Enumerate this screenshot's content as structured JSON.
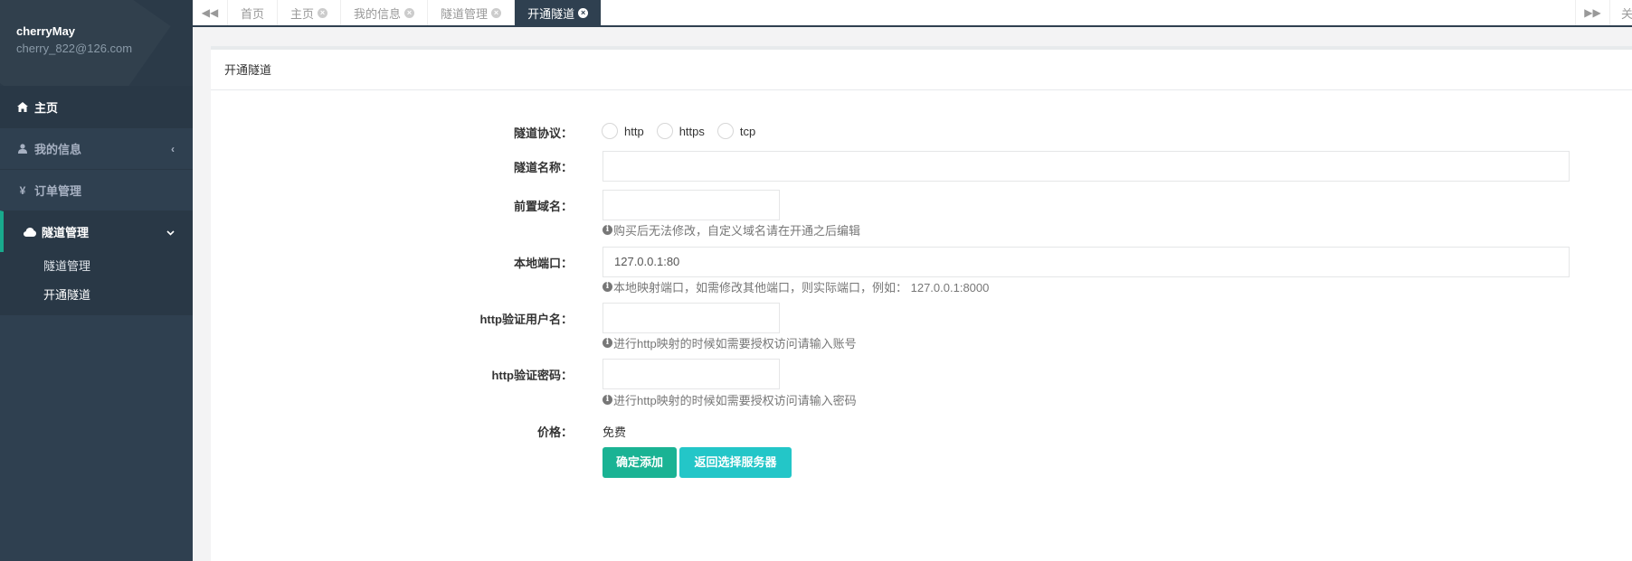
{
  "profile": {
    "name": "cherryMay",
    "email": "cherry_822@126.com"
  },
  "nav": {
    "home": "主页",
    "my_info": "我的信息",
    "orders": "订单管理",
    "tunnels": "隧道管理",
    "sub": [
      "隧道管理",
      "开通隧道"
    ]
  },
  "tabs": {
    "items": [
      {
        "label": "首页",
        "closable": false
      },
      {
        "label": "主页",
        "closable": true
      },
      {
        "label": "我的信息",
        "closable": true
      },
      {
        "label": "隧道管理",
        "closable": true
      },
      {
        "label": "开通隧道",
        "closable": true,
        "active": true
      }
    ],
    "close_label": "关闭"
  },
  "page": {
    "title": "开通隧道",
    "form": {
      "protocol_label": "隧道协议：",
      "protocol_options": [
        "http",
        "https",
        "tcp"
      ],
      "name_label": "隧道名称：",
      "name_value": "",
      "prefix_label": "前置域名：",
      "prefix_value": "",
      "prefix_help": "购买后无法修改，自定义域名请在开通之后编辑",
      "port_label": "本地端口：",
      "port_value": "127.0.0.1:80",
      "port_help": "本地映射端口，如需修改其他端口，则实际端口，例如： 127.0.0.1:8000",
      "user_label": "http验证用户名：",
      "user_value": "",
      "user_help": "进行http映射的时候如需要授权访问请输入账号",
      "pass_label": "http验证密码：",
      "pass_value": "",
      "pass_help": "进行http映射的时候如需要授权访问请输入密码",
      "price_label": "价格：",
      "price_value": "免费",
      "submit_label": "确定添加",
      "back_label": "返回选择服务器"
    }
  },
  "colors": {
    "sidebar": "#2f4050",
    "primary": "#1ab394",
    "info": "#23c6c8"
  }
}
